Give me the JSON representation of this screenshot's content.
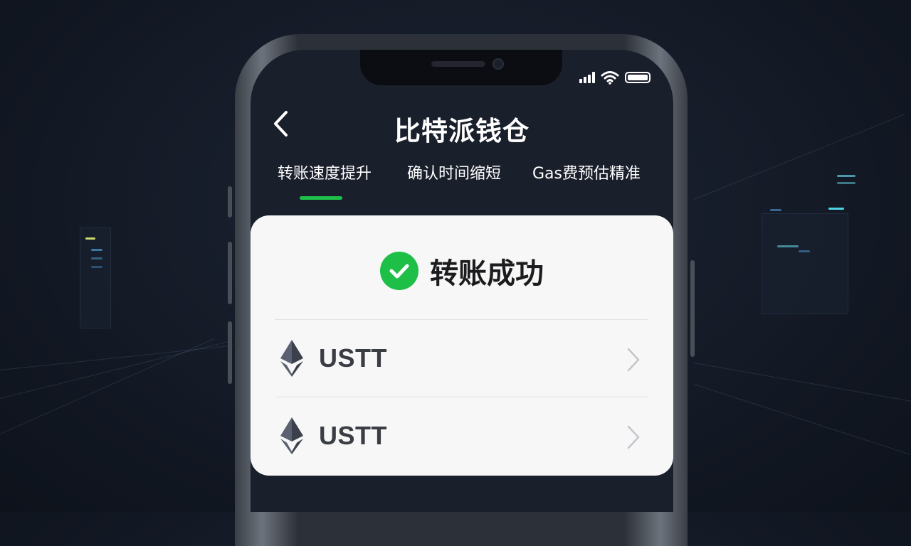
{
  "app": {
    "title": "比特派钱仓"
  },
  "nav": {
    "back_icon": "chevron-left-icon"
  },
  "status_bar": {
    "icons": [
      "signal-icon",
      "wifi-icon",
      "battery-icon"
    ]
  },
  "tabs": [
    {
      "label": "转账速度提升",
      "active": true
    },
    {
      "label": "确认时间缩短",
      "active": false
    },
    {
      "label": "Gas费预估精准",
      "active": false
    }
  ],
  "result": {
    "icon": "check-circle-icon",
    "message": "转账成功"
  },
  "tokens": [
    {
      "name": "USTT",
      "icon": "ethereum-icon"
    },
    {
      "name": "USTT",
      "icon": "ethereum-icon"
    }
  ],
  "colors": {
    "accent_green": "#1ebf47",
    "screen_bg": "#1a1f2c",
    "card_bg": "#f7f7f8",
    "page_bg": "#141a26"
  }
}
